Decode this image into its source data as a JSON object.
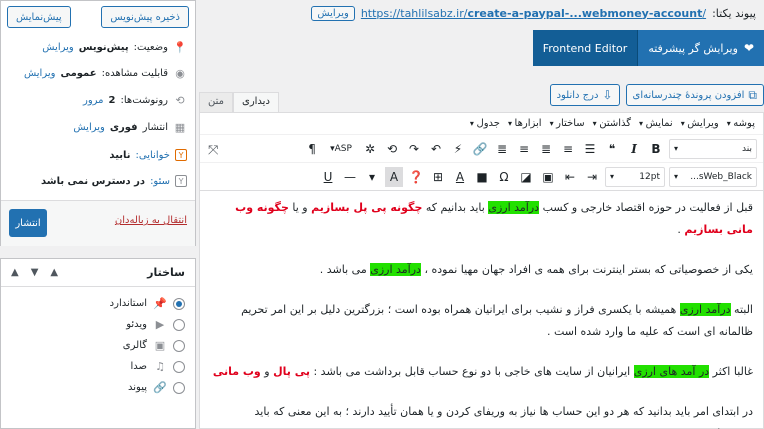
{
  "permalink": {
    "label": "پیوند یکتا:",
    "url_prefix": "https://tahlilsabz.ir/",
    "url_slug": "create-a-paypal-...webmoney-account",
    "url_suffix": "/",
    "edit_label": "ویرایش"
  },
  "builder": {
    "advanced_edit": "ویرایش گر پیشرفته",
    "frontend_editor": "Frontend Editor"
  },
  "media": {
    "add_media": "افزودن پروندهٔ چندرسانه‌ای",
    "insert_download": "درج دانلود"
  },
  "editor_tabs": {
    "visual": "دیداری",
    "text": "متن"
  },
  "menubar": [
    "پوشه",
    "ویرایش",
    "نمایش",
    "گذاشتن",
    "ساختار",
    "ابزارها",
    "جدول"
  ],
  "toolbar": {
    "format_select": "بند",
    "font_select": "sWeb_Black...",
    "size_select": "12pt",
    "asp_label": "ASP"
  },
  "content": {
    "p1_a": "قبل از فعالیت در حوزه اقتصاد خارجی و کسب ",
    "p1_hl": "درآمد ارزی",
    "p1_b": " باید بدانیم که ",
    "p1_red1": "چگونه پی پل بسازیم",
    "p1_c": " و یا ",
    "p1_red2": "چگونه وب مانی بسازیم",
    "p1_d": " .",
    "p2_a": "یکی از خصوصیاتی که بستر اینترنت برای همه ی افراد جهان مهیا نموده ، ",
    "p2_hl": "درآمد ارزی",
    "p2_b": " می باشد .",
    "p3_a": "البته ",
    "p3_hl": "درآمد ارزی",
    "p3_b": " همیشه با یکسری فراز و نشیب برای ایرانیان همراه بوده است ؛ بزرگترین دلیل بر این امر تحریم ظالمانه ای است که علیه ما وارد شده است .",
    "p4_a": "غالبا اکثر ",
    "p4_hl": "در آمد های ارزی",
    "p4_b": " ایرانیان از سایت های خاجی با دو نوع حساب قابل برداشت می باشد : ",
    "p4_red1": "پی پال",
    "p4_c": " و ",
    "p4_red2": "وب مانی",
    "p5": "در ابتدای امر باید بدانید که هر دو این حساب ها نیاز به وریفای کردن و یا همان تأیید دارند ؛ به این معنی که باید مشخصات حقیقی"
  },
  "publish": {
    "save_draft": "ذخیره پیش‌نویس",
    "preview": "پیش‌نمایش",
    "status_label": "وضعیت:",
    "status_value": "پیش‌نویس",
    "visibility_label": "قابلیت مشاهده:",
    "visibility_value": "عمومی",
    "revisions_label": "رونوشت‌ها:",
    "revisions_value": "2",
    "revisions_link": "مرور",
    "publish_label": "انتشار",
    "publish_value": "فوری",
    "readability_link": "خوانایی:",
    "readability_value": "نابید",
    "seo_link": "سئو:",
    "seo_value": "در دسترس نمی باشد",
    "edit_link": "ویرایش",
    "trash_link": "انتقال به زباله‌دان",
    "publish_button": "انتشار"
  },
  "format_box": {
    "title": "ساختار",
    "items": [
      {
        "label": "استاندارد",
        "icon": "pin-icon",
        "checked": true
      },
      {
        "label": "ویدئو",
        "icon": "video-icon",
        "checked": false
      },
      {
        "label": "گالری",
        "icon": "gallery-icon",
        "checked": false
      },
      {
        "label": "صدا",
        "icon": "audio-icon",
        "checked": false
      },
      {
        "label": "پیوند",
        "icon": "link-icon",
        "checked": false
      }
    ]
  },
  "colors": {
    "primary": "#2271b1",
    "highlight": "#22e000",
    "red_text": "#e0001c"
  }
}
